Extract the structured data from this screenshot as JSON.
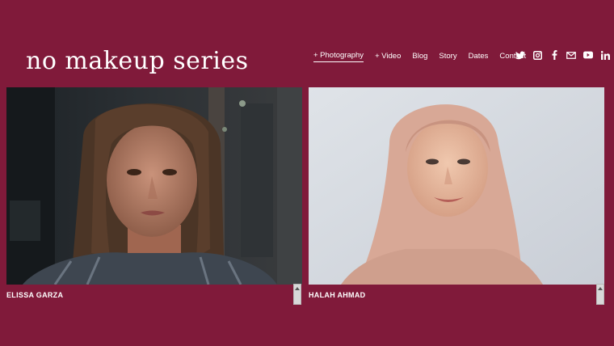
{
  "logo": {
    "text_a": "no makeup ser",
    "text_b": "i",
    "text_c": "es"
  },
  "nav": {
    "items": [
      {
        "label": "+ Photography",
        "active": true
      },
      {
        "label": "+ Video"
      },
      {
        "label": "Blog"
      },
      {
        "label": "Story"
      },
      {
        "label": "Dates"
      },
      {
        "label": "Contact"
      }
    ]
  },
  "social": [
    "twitter-icon",
    "instagram-icon",
    "facebook-icon",
    "mail-icon",
    "youtube-icon",
    "linkedin-icon"
  ],
  "cards": [
    {
      "name": "ELISSA GARZA"
    },
    {
      "name": "HALAH AHMAD"
    }
  ],
  "colors": {
    "background": "#801a3a",
    "text": "#ffffff"
  }
}
